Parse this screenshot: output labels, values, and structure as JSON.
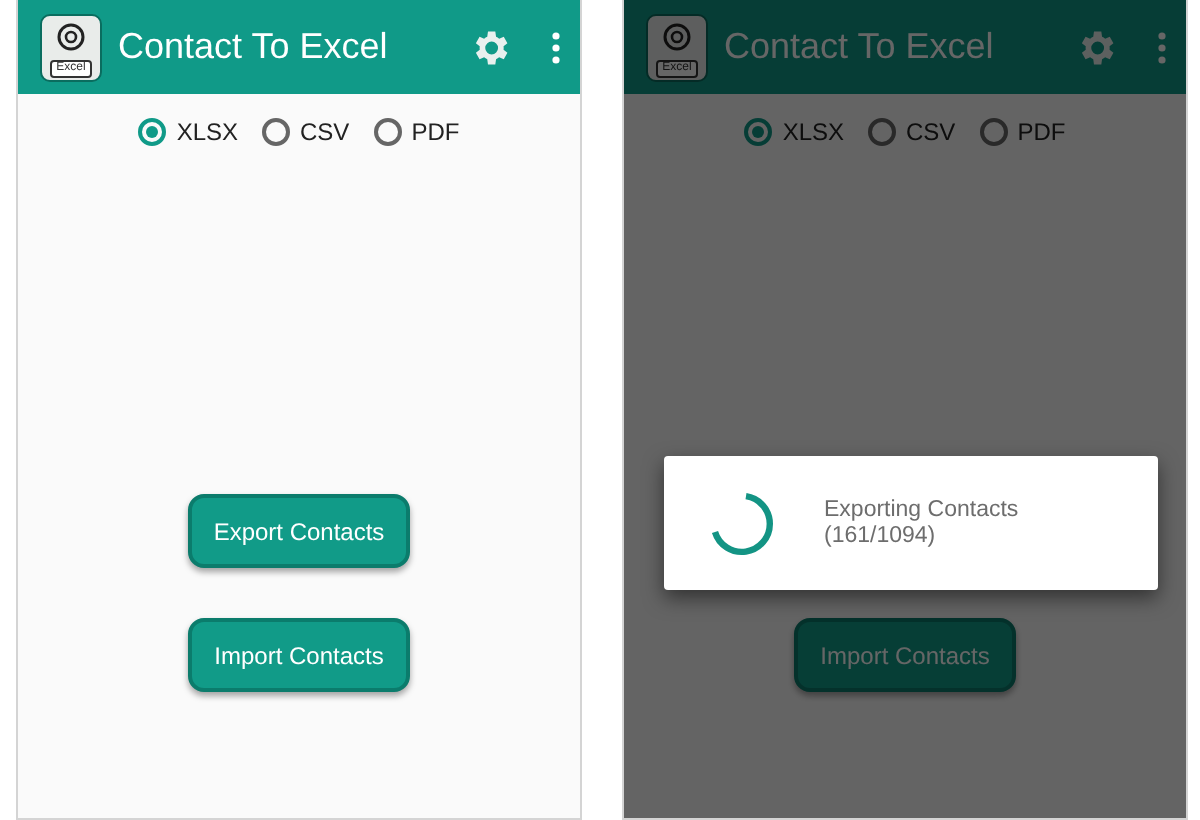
{
  "screens": [
    {
      "app_bar": {
        "logo_label": "Excel",
        "title": "Contact To Excel"
      },
      "formats": [
        {
          "label": "XLSX",
          "selected": true
        },
        {
          "label": "CSV",
          "selected": false
        },
        {
          "label": "PDF",
          "selected": false
        }
      ],
      "buttons": [
        {
          "label": "Export Contacts",
          "kind": "export"
        },
        {
          "label": "Import Contacts",
          "kind": "import"
        }
      ],
      "dimmed": false
    },
    {
      "app_bar": {
        "logo_label": "Excel",
        "title": "Contact To Excel"
      },
      "formats": [
        {
          "label": "XLSX",
          "selected": true
        },
        {
          "label": "CSV",
          "selected": false
        },
        {
          "label": "PDF",
          "selected": false
        }
      ],
      "buttons": [
        {
          "label": "Import Contacts",
          "kind": "import"
        }
      ],
      "dimmed": true,
      "dialog": {
        "message": "Exporting Contacts",
        "progress": "(161/1094)"
      }
    }
  ]
}
